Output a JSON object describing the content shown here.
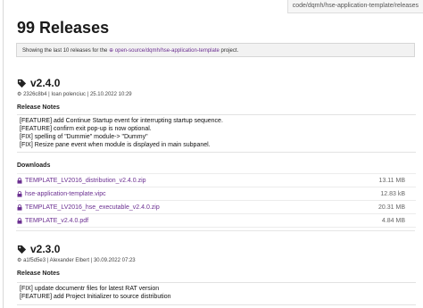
{
  "breadcrumb": "code/dqmh/hse-application-template/releases",
  "page_title": "99 Releases",
  "info": {
    "prefix": "Showing the last 10 releases for the ",
    "project": "open-source/dqmh/hse-application-template",
    "suffix": " project."
  },
  "releases": [
    {
      "version": "v2.4.0",
      "commit": "2326c8b4",
      "author": "Ioan polenciuc",
      "date": "25.10.2022 10:29",
      "notes_label": "Release Notes",
      "notes": [
        "[FEATURE] add Continue Startup event for interrupting startup sequence.",
        "[FEATURE] confirm exit pop-up is now optional.",
        "[FIX] spelling of \"Dummie\" module-> \"Dummy\"",
        "[FIX] Resize pane event when module is displayed in main subpanel."
      ],
      "downloads_label": "Downloads",
      "downloads": [
        {
          "name": "TEMPLATE_LV2016_distribution_v2.4.0.zip",
          "size": "13.11 MB"
        },
        {
          "name": "hse-application-template.vipc",
          "size": "12.83 kB"
        },
        {
          "name": "TEMPLATE_LV2016_hse_executable_v2.4.0.zip",
          "size": "20.31 MB"
        },
        {
          "name": "TEMPLATE_v2.4.0.pdf",
          "size": "4.84 MB"
        }
      ]
    },
    {
      "version": "v2.3.0",
      "commit": "a1f5d5e3",
      "author": "Alexander Elbert",
      "date": "30.09.2022 07:23",
      "notes_label": "Release Notes",
      "notes": [
        "[FIX] update documentr files for latest RAT version",
        "[FEATURE] add Project Initializer to source distribution"
      ]
    }
  ],
  "colors": {
    "link": "#6b2f91",
    "info_bg": "#f2f2f2"
  }
}
